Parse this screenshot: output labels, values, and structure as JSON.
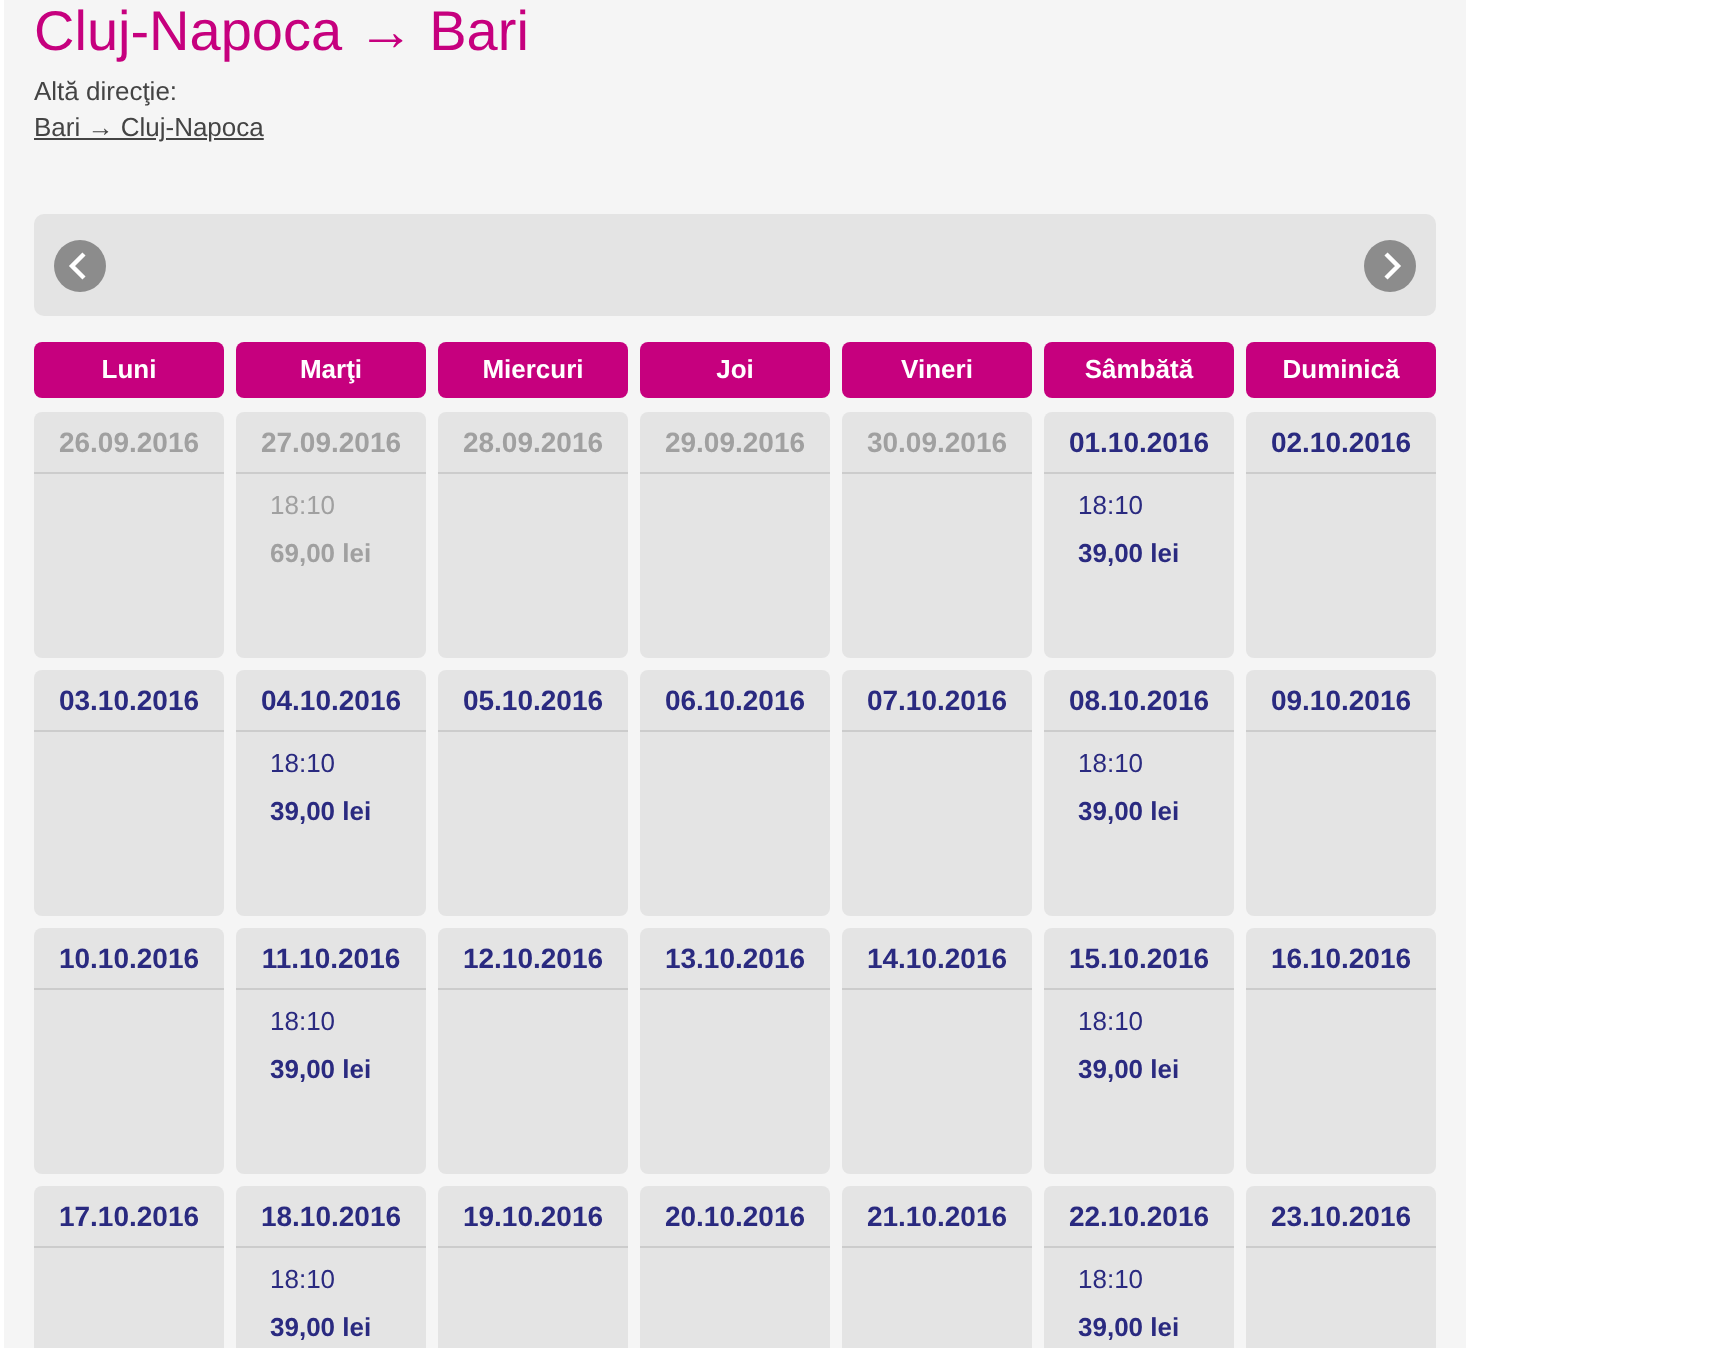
{
  "title": "Cluj-Napoca → Bari",
  "other_direction": {
    "label": "Altă direcţie:",
    "link": "Bari → Cluj-Napoca"
  },
  "weekdays": [
    "Luni",
    "Marţi",
    "Miercuri",
    "Joi",
    "Vineri",
    "Sâmbătă",
    "Duminică"
  ],
  "weeks": [
    {
      "days": [
        {
          "date": "26.09.2016",
          "past": true
        },
        {
          "date": "27.09.2016",
          "past": true,
          "flights": [
            {
              "time": "18:10",
              "price": "69,00 lei"
            }
          ]
        },
        {
          "date": "28.09.2016",
          "past": true
        },
        {
          "date": "29.09.2016",
          "past": true
        },
        {
          "date": "30.09.2016",
          "past": true
        },
        {
          "date": "01.10.2016",
          "past": false,
          "flights": [
            {
              "time": "18:10",
              "price": "39,00 lei"
            }
          ]
        },
        {
          "date": "02.10.2016",
          "past": false
        }
      ]
    },
    {
      "days": [
        {
          "date": "03.10.2016",
          "past": false
        },
        {
          "date": "04.10.2016",
          "past": false,
          "flights": [
            {
              "time": "18:10",
              "price": "39,00 lei"
            }
          ]
        },
        {
          "date": "05.10.2016",
          "past": false
        },
        {
          "date": "06.10.2016",
          "past": false
        },
        {
          "date": "07.10.2016",
          "past": false
        },
        {
          "date": "08.10.2016",
          "past": false,
          "flights": [
            {
              "time": "18:10",
              "price": "39,00 lei"
            }
          ]
        },
        {
          "date": "09.10.2016",
          "past": false
        }
      ]
    },
    {
      "days": [
        {
          "date": "10.10.2016",
          "past": false
        },
        {
          "date": "11.10.2016",
          "past": false,
          "flights": [
            {
              "time": "18:10",
              "price": "39,00 lei"
            }
          ]
        },
        {
          "date": "12.10.2016",
          "past": false
        },
        {
          "date": "13.10.2016",
          "past": false
        },
        {
          "date": "14.10.2016",
          "past": false
        },
        {
          "date": "15.10.2016",
          "past": false,
          "flights": [
            {
              "time": "18:10",
              "price": "39,00 lei"
            }
          ]
        },
        {
          "date": "16.10.2016",
          "past": false
        }
      ]
    },
    {
      "days": [
        {
          "date": "17.10.2016",
          "past": false
        },
        {
          "date": "18.10.2016",
          "past": false,
          "flights": [
            {
              "time": "18:10",
              "price": "39,00 lei"
            }
          ]
        },
        {
          "date": "19.10.2016",
          "past": false
        },
        {
          "date": "20.10.2016",
          "past": false
        },
        {
          "date": "21.10.2016",
          "past": false
        },
        {
          "date": "22.10.2016",
          "past": false,
          "flights": [
            {
              "time": "18:10",
              "price": "39,00 lei"
            }
          ]
        },
        {
          "date": "23.10.2016",
          "past": false
        }
      ]
    }
  ]
}
